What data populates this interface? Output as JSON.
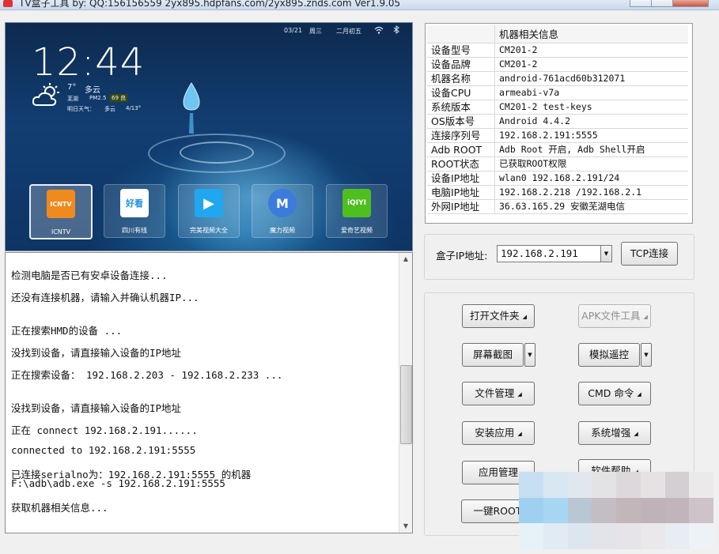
{
  "window": {
    "title": "TV盒子工具 by: QQ:156156559  2yx895.hdpfans.com/2yx895.znds.com   Ver1.9.05"
  },
  "preview": {
    "date": "03/21",
    "weekday": "周三",
    "lunar": "二月初五",
    "clock": "12:44",
    "temperature": "7°",
    "weather": "多云",
    "city": "芜湖",
    "pm_label": "PM2.5",
    "aqi": "69 良",
    "tomorrow_label": "明日天气：",
    "tomorrow_weather": "多云",
    "tomorrow_temp": "4/13°",
    "apps": [
      {
        "label": "ICNTV",
        "icon_text": "ICNTV",
        "color": "#f08a1c"
      },
      {
        "label": "四川有线",
        "icon_text": "好看",
        "color": "#1e8fe0"
      },
      {
        "label": "完美视频大全",
        "icon_text": "▶",
        "color": "#21a7ef"
      },
      {
        "label": "魔力视频",
        "icon_text": "M",
        "color": "#3b7bdc"
      },
      {
        "label": "爱奇艺视频",
        "icon_text": "iQIYI",
        "color": "#4fbf20"
      }
    ]
  },
  "log": {
    "lines": [
      "检测电脑是否已有安卓设备连接...",
      "还没有连接机器，请输入并确认机器IP...",
      "正在搜索HMD的设备 ...",
      "没找到设备，请直接输入设备的IP地址",
      "正在搜索设备： 192.168.2.203 - 192.168.2.233 ...",
      "没找到设备，请直接输入设备的IP地址",
      "正在 connect 192.168.2.191......",
      "connected to 192.168.2.191:5555",
      "已连接serialno为：192.168.2.191:5555 的机器",
      "F:\\adb\\adb.exe -s 192.168.2.191:5555",
      "获取机器相关信息..."
    ]
  },
  "info": {
    "header": "机器相关信息",
    "rows": [
      {
        "key": "设备型号",
        "value": "CM201-2"
      },
      {
        "key": "设备品牌",
        "value": "CM201-2"
      },
      {
        "key": "机器名称",
        "value": "android-761acd60b312071"
      },
      {
        "key": "设备CPU",
        "value": "armeabi-v7a"
      },
      {
        "key": "系统版本",
        "value": "CM201-2 test-keys"
      },
      {
        "key": "OS版本号",
        "value": "Android 4.4.2"
      },
      {
        "key": "连接序列号",
        "value": "192.168.2.191:5555"
      },
      {
        "key": "Adb ROOT",
        "value": "Adb Root 开启, Adb Shell开启"
      },
      {
        "key": "ROOT状态",
        "value": "已获取ROOT权限"
      },
      {
        "key": "设备IP地址",
        "value": "wlan0 192.168.2.191/24"
      },
      {
        "key": "电脑IP地址",
        "value": "192.168.2.218 /192.168.2.1"
      },
      {
        "key": "外网IP地址",
        "value": "36.63.165.29 安徽芜湖电信"
      }
    ]
  },
  "connect": {
    "ip_label": "盒子IP地址:",
    "ip_value": "192.168.2.191",
    "tcp_button": "TCP连接"
  },
  "buttons": {
    "open_folder": "打开文件夹",
    "apk_tool": "APK文件工具",
    "screenshot": "屏幕截图",
    "remote": "模拟遥控",
    "file_manage": "文件管理",
    "cmd": "CMD 命令",
    "install_app": "安装应用",
    "system_boost": "系统增强",
    "app_manage": "应用管理",
    "software_help": "软件帮助",
    "one_key_root": "一键ROOT"
  },
  "colors": {
    "accent": "#1e8fe0",
    "preview_bg": "#123e72"
  }
}
